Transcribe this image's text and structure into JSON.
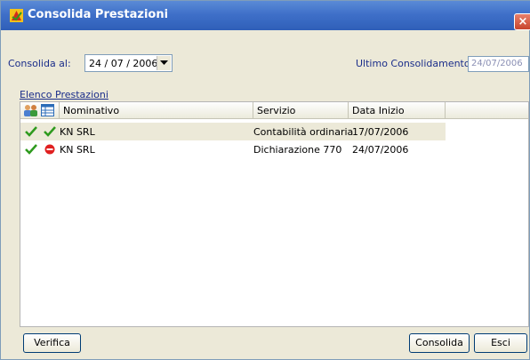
{
  "window": {
    "title": "Consolida Prestazioni",
    "close_glyph": "×"
  },
  "form": {
    "consolida_label": "Consolida al:",
    "consolida_date": "24 / 07 / 2006",
    "ultimo_label": "Ultimo Consolidamento:",
    "ultimo_value": "24/07/2006"
  },
  "list": {
    "section_label": "Elenco Prestazioni",
    "header_icons": [
      "users-icon",
      "table-icon"
    ],
    "columns": [
      "Nominativo",
      "Servizio",
      "Data Inizio"
    ],
    "rows": [
      {
        "icon1": "check-icon",
        "icon2": "check-icon",
        "nominativo": "KN SRL",
        "servizio": "Contabilità ordinaria",
        "data_inizio": "17/07/2006",
        "selected": true
      },
      {
        "icon1": "check-icon",
        "icon2": "no-entry-icon",
        "nominativo": "KN SRL",
        "servizio": "Dichiarazione 770",
        "data_inizio": "24/07/2006",
        "selected": false
      }
    ]
  },
  "buttons": {
    "verifica": "Verifica",
    "consolida": "Consolida",
    "esci": "Esci"
  },
  "colors": {
    "title_bar": "#3f70c9",
    "label_text": "#1a2d8a",
    "check_green": "#2e9a1e",
    "stop_red": "#e02020"
  }
}
